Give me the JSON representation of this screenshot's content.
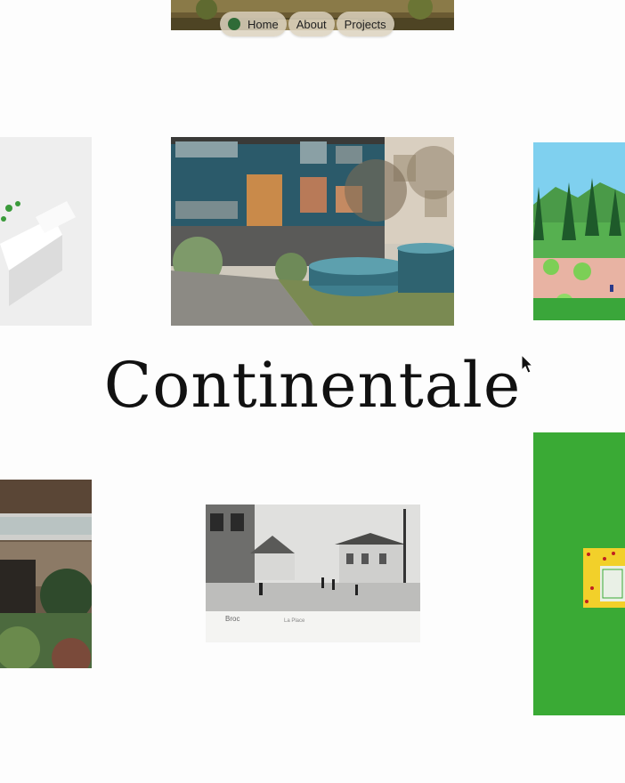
{
  "nav": {
    "items": [
      {
        "label": "Home",
        "icon": "green-dot-icon"
      },
      {
        "label": "About"
      },
      {
        "label": "Projects"
      }
    ],
    "accent": "#2f6b37"
  },
  "project": {
    "title": "Continentale"
  },
  "tiles": [
    {
      "name": "tile-top",
      "content": "landscape-photo"
    },
    {
      "name": "tile-center",
      "content": "apartment-courtyard-fountain-photo"
    },
    {
      "name": "tile-left-top",
      "content": "white-architectural-model"
    },
    {
      "name": "tile-right-top",
      "content": "park-illustration"
    },
    {
      "name": "tile-left-bottom",
      "content": "building-garden-photo"
    },
    {
      "name": "tile-bottom-center",
      "content": "historic-postcard"
    },
    {
      "name": "tile-right-bottom",
      "content": "green-plan-drawing"
    }
  ],
  "postcard": {
    "place": "Broc",
    "caption": "La Place"
  },
  "colors": {
    "background": "#fdfdfd",
    "pill": "#dcd2be",
    "plan_green": "#3aaa35",
    "plan_yellow": "#f2d02a"
  }
}
